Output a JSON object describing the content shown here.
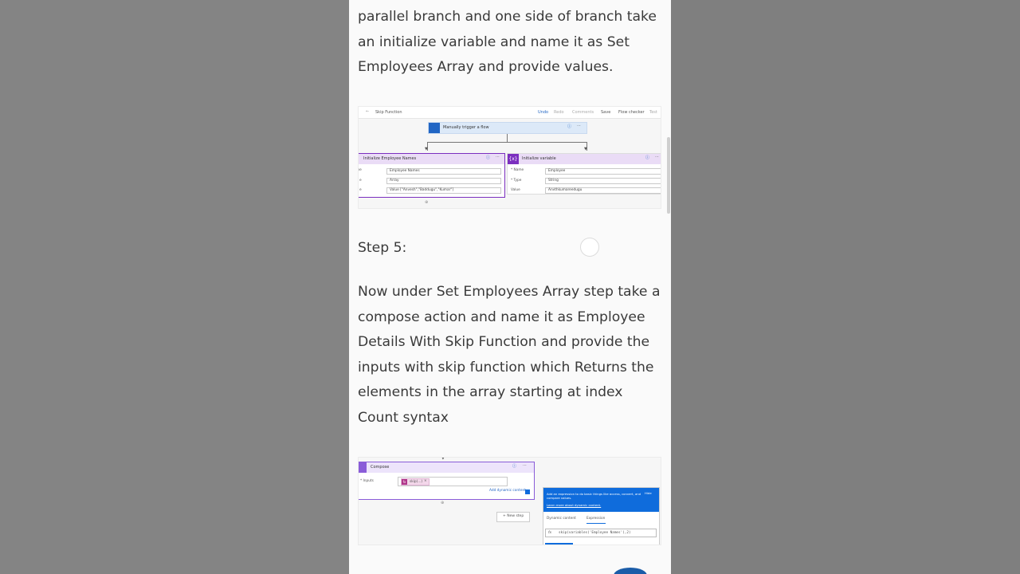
{
  "article": {
    "para_top": "parallel branch and one side of branch take an initialize variable and name it as Set Employees Array and provide values.",
    "step5_heading": "Step 5:",
    "step5_body": "Now under Set Employees Array step take a compose action and name it as Employee Details With Skip Function and provide the inputs with skip function which Returns the elements in the array starting at index Count syntax"
  },
  "shot1": {
    "flow_name": "Skip Function",
    "toolbar": {
      "undo": "Undo",
      "redo": "Redo",
      "comments": "Comments",
      "save": "Save",
      "flow_checker": "Flow checker",
      "test": "Test"
    },
    "trigger_title": "Manually trigger a flow",
    "left_card": {
      "title": "Initialize Employee Names",
      "labels": [
        "me",
        "e",
        "e"
      ],
      "fields": [
        "Employee Names",
        "Array",
        "Value [\"Anvesh\",\"Baddugu\",\"Kumar\"]"
      ]
    },
    "right_card": {
      "title": "Initialize variable",
      "labels": [
        "* Name",
        "* Type",
        "Value"
      ],
      "fields": [
        "Employee",
        "String",
        "Anvthkumareedugu"
      ]
    },
    "colors": {
      "trigger": "#2266c4",
      "variable": "#7b2fbf",
      "card_header": "#eadcf6"
    }
  },
  "shot2": {
    "compose_title": "Compose",
    "inputs_label": "* Inputs",
    "token_label": "skip(...)",
    "add_dynamic_label": "Add dynamic content",
    "new_step_label": "+ New step",
    "popup_text": "Add an expression to do basic things like access, convert, and compare values.",
    "popup_link": "Learn more about dynamic content.",
    "popup_hide": "Hide",
    "tab_dynamic": "Dynamic content",
    "tab_expression": "Expression",
    "fx_symbol": "fx",
    "expression": "skip(variables('Employee Names'),2)",
    "colors": {
      "compose": "#8a5cd8",
      "popup": "#0f6cdc"
    }
  }
}
